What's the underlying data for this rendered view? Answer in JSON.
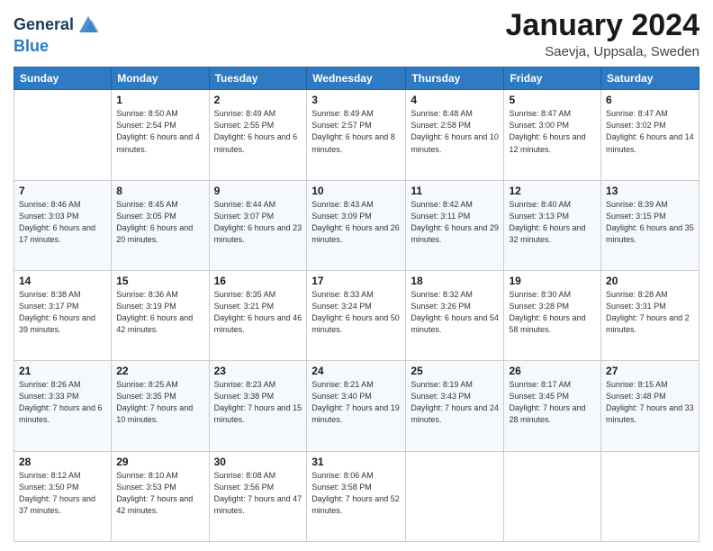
{
  "logo": {
    "line1": "General",
    "line2": "Blue"
  },
  "header": {
    "title": "January 2024",
    "location": "Saevja, Uppsala, Sweden"
  },
  "days_of_week": [
    "Sunday",
    "Monday",
    "Tuesday",
    "Wednesday",
    "Thursday",
    "Friday",
    "Saturday"
  ],
  "weeks": [
    [
      {
        "day": "",
        "info": ""
      },
      {
        "day": "1",
        "info": "Sunrise: 8:50 AM\nSunset: 2:54 PM\nDaylight: 6 hours\nand 4 minutes."
      },
      {
        "day": "2",
        "info": "Sunrise: 8:49 AM\nSunset: 2:55 PM\nDaylight: 6 hours\nand 6 minutes."
      },
      {
        "day": "3",
        "info": "Sunrise: 8:49 AM\nSunset: 2:57 PM\nDaylight: 6 hours\nand 8 minutes."
      },
      {
        "day": "4",
        "info": "Sunrise: 8:48 AM\nSunset: 2:58 PM\nDaylight: 6 hours\nand 10 minutes."
      },
      {
        "day": "5",
        "info": "Sunrise: 8:47 AM\nSunset: 3:00 PM\nDaylight: 6 hours\nand 12 minutes."
      },
      {
        "day": "6",
        "info": "Sunrise: 8:47 AM\nSunset: 3:02 PM\nDaylight: 6 hours\nand 14 minutes."
      }
    ],
    [
      {
        "day": "7",
        "info": "Sunrise: 8:46 AM\nSunset: 3:03 PM\nDaylight: 6 hours\nand 17 minutes."
      },
      {
        "day": "8",
        "info": "Sunrise: 8:45 AM\nSunset: 3:05 PM\nDaylight: 6 hours\nand 20 minutes."
      },
      {
        "day": "9",
        "info": "Sunrise: 8:44 AM\nSunset: 3:07 PM\nDaylight: 6 hours\nand 23 minutes."
      },
      {
        "day": "10",
        "info": "Sunrise: 8:43 AM\nSunset: 3:09 PM\nDaylight: 6 hours\nand 26 minutes."
      },
      {
        "day": "11",
        "info": "Sunrise: 8:42 AM\nSunset: 3:11 PM\nDaylight: 6 hours\nand 29 minutes."
      },
      {
        "day": "12",
        "info": "Sunrise: 8:40 AM\nSunset: 3:13 PM\nDaylight: 6 hours\nand 32 minutes."
      },
      {
        "day": "13",
        "info": "Sunrise: 8:39 AM\nSunset: 3:15 PM\nDaylight: 6 hours\nand 35 minutes."
      }
    ],
    [
      {
        "day": "14",
        "info": "Sunrise: 8:38 AM\nSunset: 3:17 PM\nDaylight: 6 hours\nand 39 minutes."
      },
      {
        "day": "15",
        "info": "Sunrise: 8:36 AM\nSunset: 3:19 PM\nDaylight: 6 hours\nand 42 minutes."
      },
      {
        "day": "16",
        "info": "Sunrise: 8:35 AM\nSunset: 3:21 PM\nDaylight: 6 hours\nand 46 minutes."
      },
      {
        "day": "17",
        "info": "Sunrise: 8:33 AM\nSunset: 3:24 PM\nDaylight: 6 hours\nand 50 minutes."
      },
      {
        "day": "18",
        "info": "Sunrise: 8:32 AM\nSunset: 3:26 PM\nDaylight: 6 hours\nand 54 minutes."
      },
      {
        "day": "19",
        "info": "Sunrise: 8:30 AM\nSunset: 3:28 PM\nDaylight: 6 hours\nand 58 minutes."
      },
      {
        "day": "20",
        "info": "Sunrise: 8:28 AM\nSunset: 3:31 PM\nDaylight: 7 hours\nand 2 minutes."
      }
    ],
    [
      {
        "day": "21",
        "info": "Sunrise: 8:26 AM\nSunset: 3:33 PM\nDaylight: 7 hours\nand 6 minutes."
      },
      {
        "day": "22",
        "info": "Sunrise: 8:25 AM\nSunset: 3:35 PM\nDaylight: 7 hours\nand 10 minutes."
      },
      {
        "day": "23",
        "info": "Sunrise: 8:23 AM\nSunset: 3:38 PM\nDaylight: 7 hours\nand 15 minutes."
      },
      {
        "day": "24",
        "info": "Sunrise: 8:21 AM\nSunset: 3:40 PM\nDaylight: 7 hours\nand 19 minutes."
      },
      {
        "day": "25",
        "info": "Sunrise: 8:19 AM\nSunset: 3:43 PM\nDaylight: 7 hours\nand 24 minutes."
      },
      {
        "day": "26",
        "info": "Sunrise: 8:17 AM\nSunset: 3:45 PM\nDaylight: 7 hours\nand 28 minutes."
      },
      {
        "day": "27",
        "info": "Sunrise: 8:15 AM\nSunset: 3:48 PM\nDaylight: 7 hours\nand 33 minutes."
      }
    ],
    [
      {
        "day": "28",
        "info": "Sunrise: 8:12 AM\nSunset: 3:50 PM\nDaylight: 7 hours\nand 37 minutes."
      },
      {
        "day": "29",
        "info": "Sunrise: 8:10 AM\nSunset: 3:53 PM\nDaylight: 7 hours\nand 42 minutes."
      },
      {
        "day": "30",
        "info": "Sunrise: 8:08 AM\nSunset: 3:56 PM\nDaylight: 7 hours\nand 47 minutes."
      },
      {
        "day": "31",
        "info": "Sunrise: 8:06 AM\nSunset: 3:58 PM\nDaylight: 7 hours\nand 52 minutes."
      },
      {
        "day": "",
        "info": ""
      },
      {
        "day": "",
        "info": ""
      },
      {
        "day": "",
        "info": ""
      }
    ]
  ]
}
